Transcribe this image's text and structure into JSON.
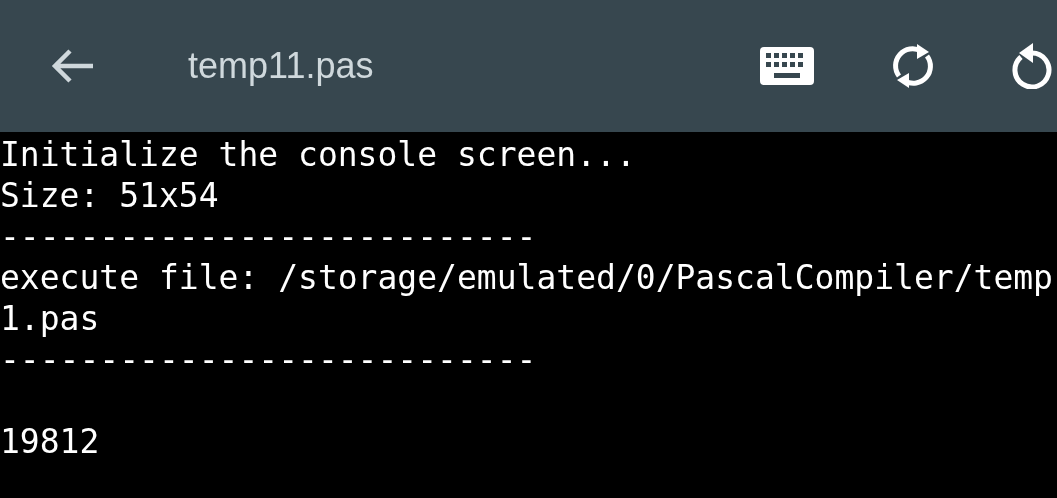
{
  "toolbar": {
    "title": "temp11.pas"
  },
  "console": {
    "lines": [
      {
        "kind": "text",
        "text": "Initialize the console screen..."
      },
      {
        "kind": "text",
        "text": "Size: 51x54"
      },
      {
        "kind": "text",
        "text": "---------------------------"
      },
      {
        "kind": "text",
        "text": "execute file: /storage/emulated/0/PascalCompiler/temp"
      },
      {
        "kind": "text",
        "text": "1.pas"
      },
      {
        "kind": "text",
        "text": "---------------------------"
      },
      {
        "kind": "blank"
      },
      {
        "kind": "text",
        "text": "19812"
      }
    ]
  }
}
